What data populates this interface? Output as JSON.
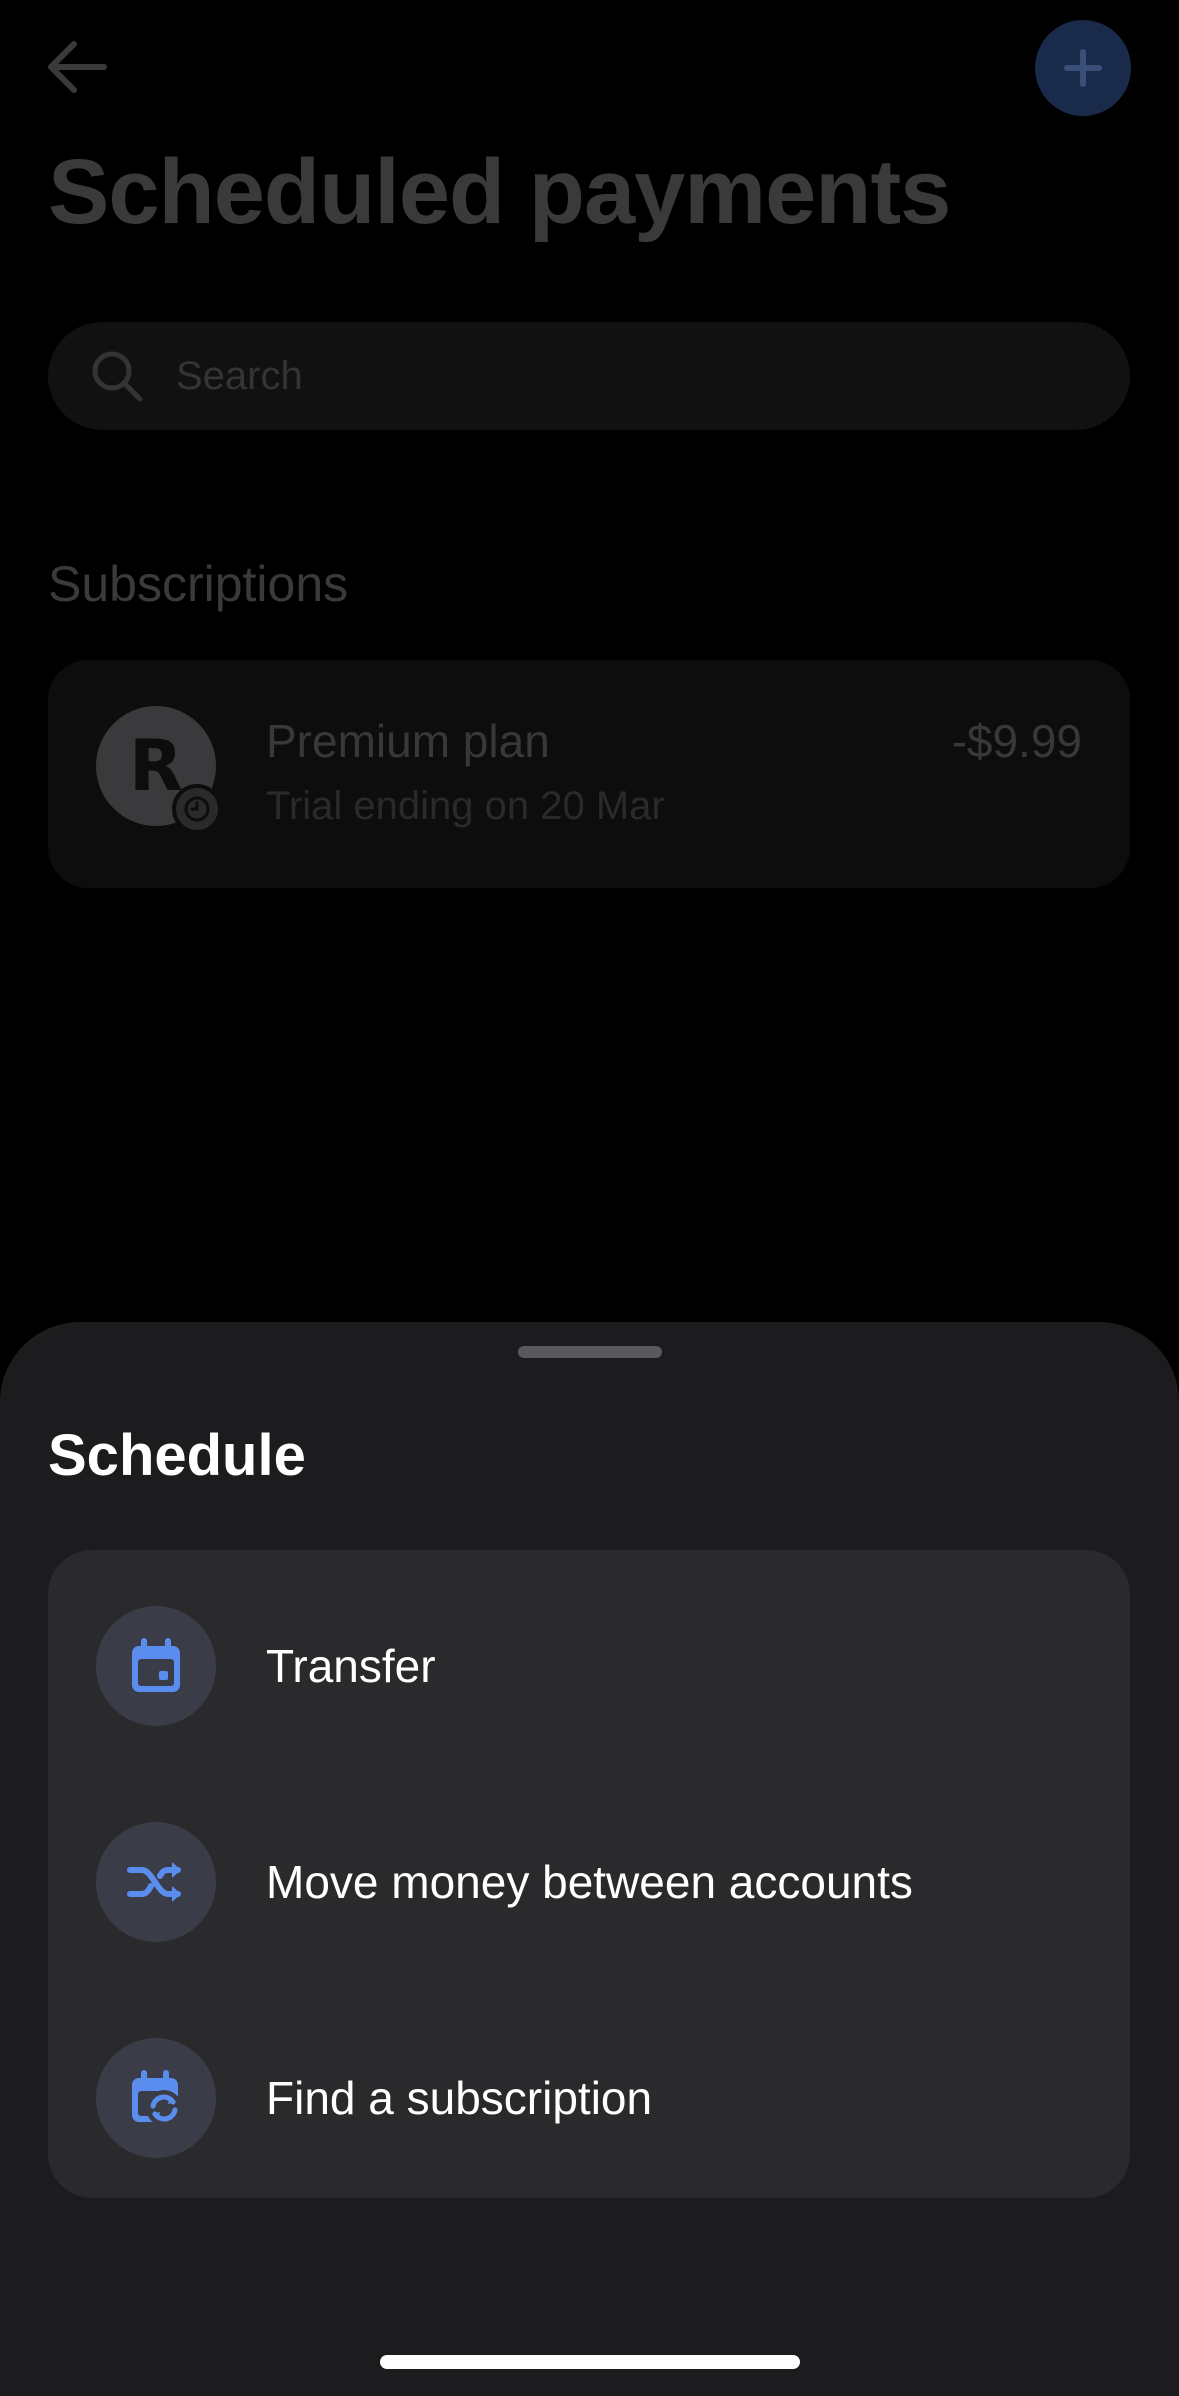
{
  "header": {
    "title": "Scheduled payments"
  },
  "search": {
    "placeholder": "Search"
  },
  "subscriptions": {
    "section_label": "Subscriptions",
    "items": [
      {
        "logo_letter": "R",
        "name": "Premium plan",
        "description": "Trial ending on 20 Mar",
        "amount": "-$9.99"
      }
    ]
  },
  "sheet": {
    "title": "Schedule",
    "options": [
      {
        "label": "Transfer",
        "icon": "calendar-icon"
      },
      {
        "label": "Move money between accounts",
        "icon": "shuffle-icon"
      },
      {
        "label": "Find a subscription",
        "icon": "calendar-repeat-icon"
      }
    ]
  },
  "colors": {
    "accent": "#5b8def",
    "sheet_bg": "#1c1c1e",
    "options_bg": "#2a2a2d"
  }
}
